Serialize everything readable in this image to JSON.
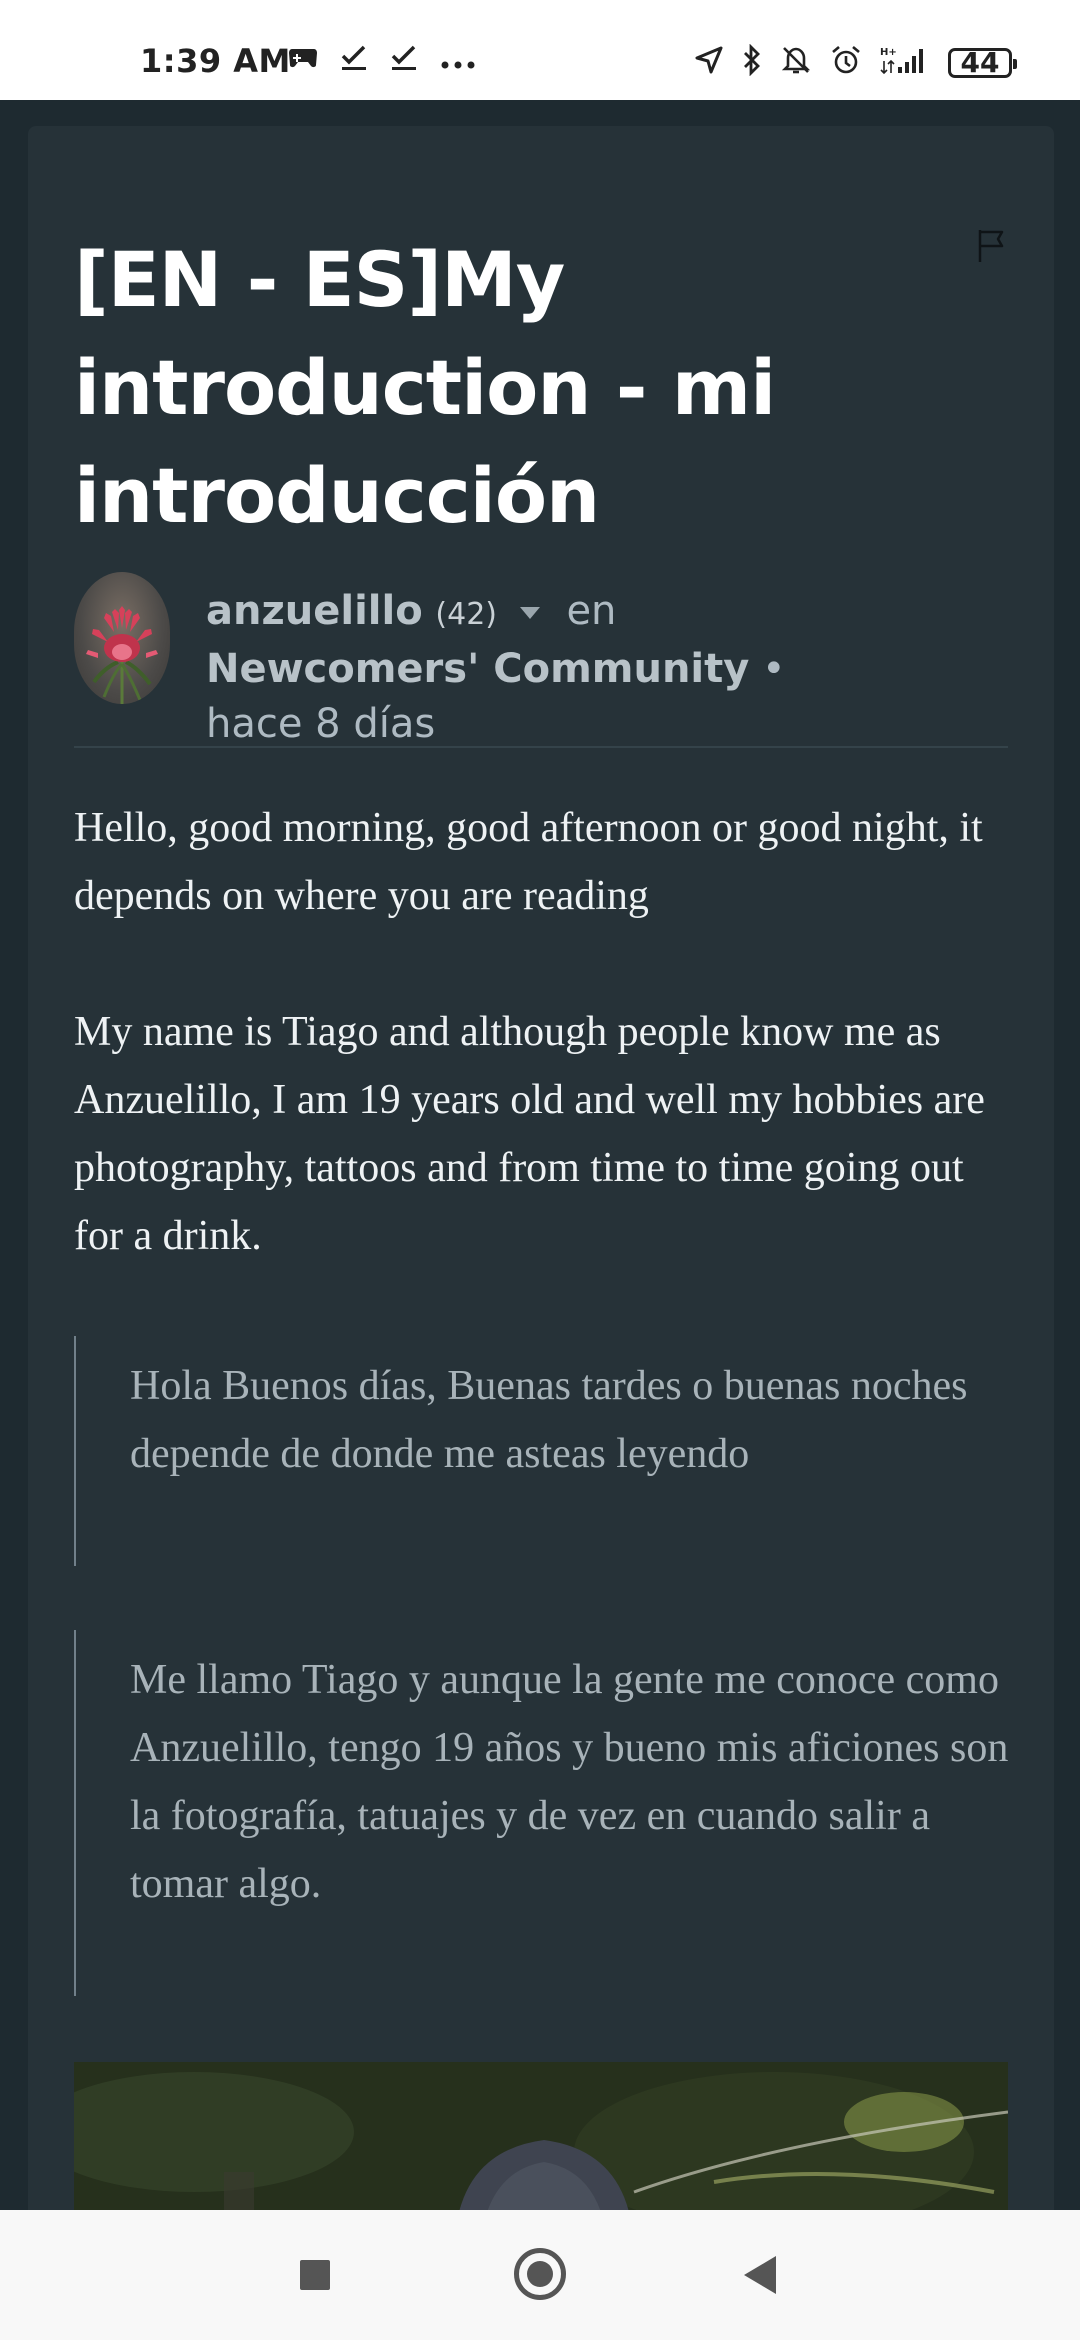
{
  "status_bar": {
    "time": "1:39 AM",
    "left_icons": [
      "game-controller-icon",
      "check-icon",
      "check-icon",
      "more-dots-icon"
    ],
    "right_icons": [
      "location-arrow-icon",
      "bluetooth-icon",
      "bell-off-icon",
      "alarm-icon",
      "signal-icon"
    ],
    "battery": "44"
  },
  "post": {
    "title": "[EN - ES]My introduction - mi introducción",
    "author": "anzuelillo",
    "reputation": "(42)",
    "in_label": "en",
    "community": "Newcomers' Community",
    "separator": "•",
    "time_ago": "hace 8 días",
    "paragraphs": [
      "Hello, good morning, good afternoon or good night, it depends on where you are reading",
      "My name is Tiago and although people know me as Anzuelillo, I am 19 years old and well my hobbies are photography, tattoos and from time to time going out for a drink."
    ],
    "quotes": [
      "Hola Buenos días, Buenas tardes o buenas noches depende de donde me asteas leyendo",
      "Me llamo Tiago y aunque la gente me conoce como Anzuelillo, tengo 19 años y bueno mis aficiones son la fotografía, tatuajes y de vez en cuando salir a tomar algo."
    ]
  },
  "nav_bar": {
    "buttons": [
      "recents-button",
      "home-button",
      "back-button"
    ]
  },
  "colors": {
    "background": "#1e2a30",
    "card": "#263238",
    "text": "#eef2f4",
    "quote_text": "#a8b3b9",
    "meta_text": "#aebac2"
  }
}
